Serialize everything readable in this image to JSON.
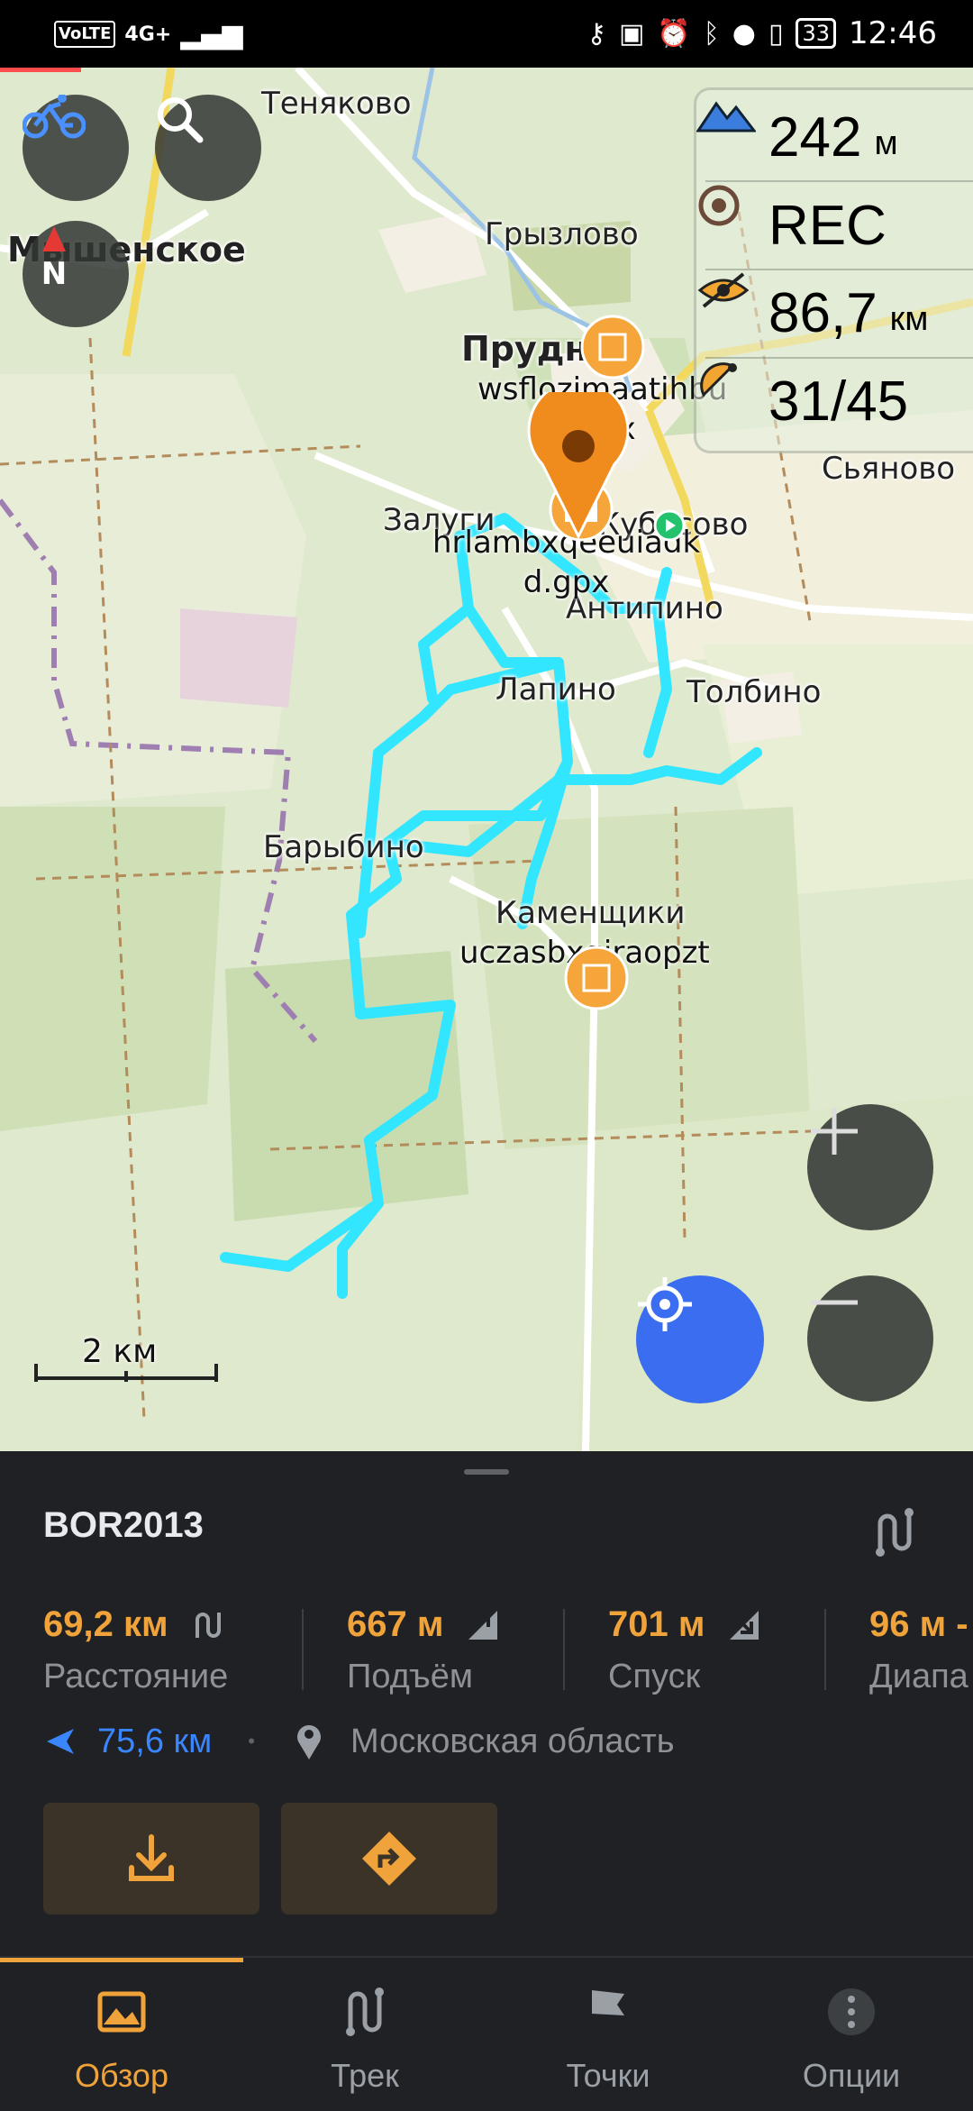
{
  "status_bar": {
    "left_badges": [
      "VoLTE",
      "4G+"
    ],
    "time": "12:46",
    "battery": "33",
    "icons": [
      "key-icon",
      "nfc-icon",
      "alarm-icon",
      "bluetooth-icon",
      "location-icon",
      "vibrate-icon"
    ]
  },
  "map": {
    "places": [
      "Теняково",
      "Мышенское",
      "Грызлово",
      "Прудно",
      "Сьяново",
      "Залуги",
      "Кубасово",
      "Антипино",
      "Лапино",
      "Толбино",
      "Барыбино",
      "Каменщики"
    ],
    "gpx_labels": [
      "wsflozjmaatihbu\n.gpx",
      "hrlambxqeeuiadk\nd.gpx",
      "uczasbxgiraopzt"
    ],
    "scale_label": "2 км",
    "track_color": "#33e6ff"
  },
  "metrics": {
    "altitude_value": "242",
    "altitude_unit": "м",
    "rec_label": "REC",
    "distance_value": "86,7",
    "distance_unit": "км",
    "satellites": "31/45"
  },
  "sheet": {
    "title": "BOR2013",
    "distance_value": "69,2 км",
    "distance_label": "Расстояние",
    "ascent_value": "667 м",
    "ascent_label": "Подъём",
    "descent_value": "701 м",
    "descent_label": "Спуск",
    "range_value": "96 м -",
    "range_label": "Диапа",
    "direction_distance": "75,6 км",
    "bullet": "•",
    "region": "Московская область"
  },
  "nav": {
    "items": [
      {
        "label": "Обзор",
        "icon": "overview-icon"
      },
      {
        "label": "Трек",
        "icon": "track-icon"
      },
      {
        "label": "Точки",
        "icon": "flag-icon"
      },
      {
        "label": "Опции",
        "icon": "more-icon"
      }
    ]
  },
  "colors": {
    "accent": "#f0a33a",
    "blue": "#3a86ff",
    "sheet_bg": "#202124"
  }
}
